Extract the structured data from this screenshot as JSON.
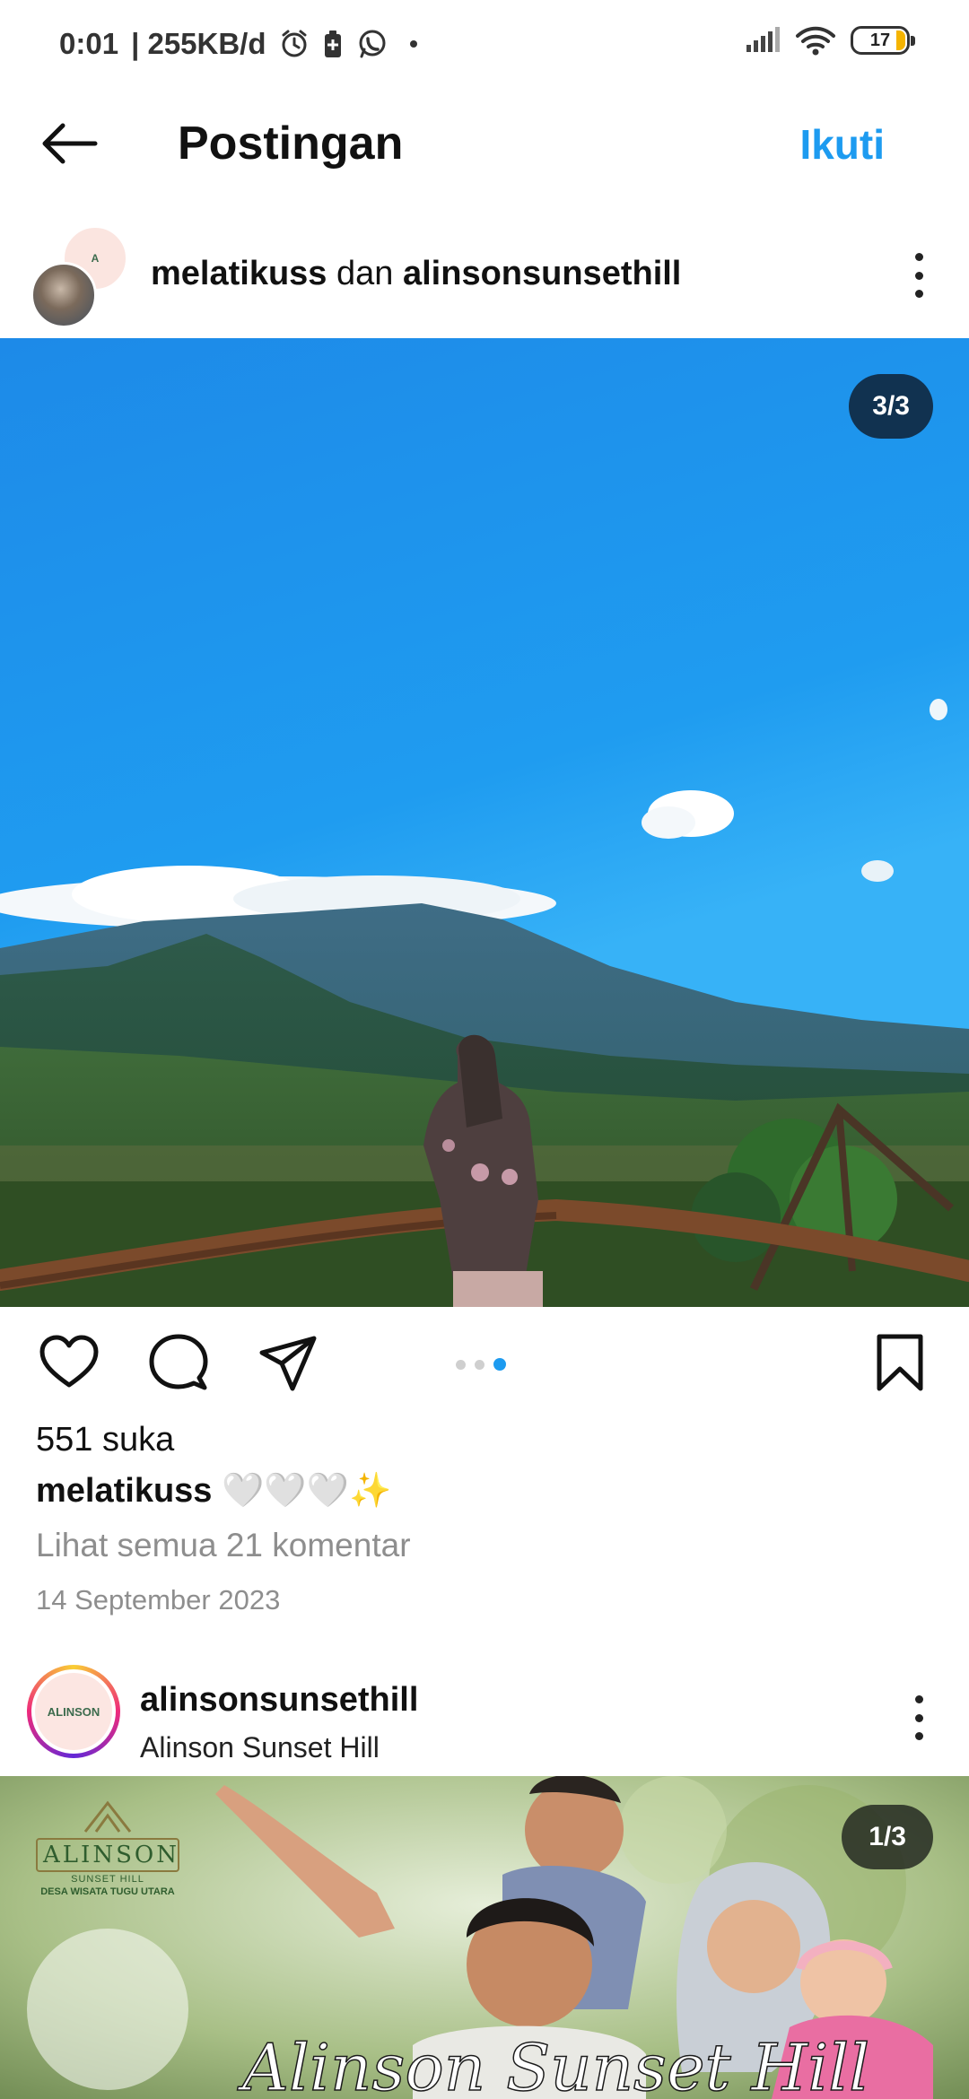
{
  "status_bar": {
    "time": "0:01",
    "speed": "| 255KB/d",
    "battery": "17"
  },
  "header": {
    "title": "Postingan",
    "follow_label": "Ikuti"
  },
  "post": {
    "user1": "melatikuss",
    "connector": "dan",
    "user2": "alinsonsunsethill",
    "image_counter": "3/3",
    "likes": "551 suka",
    "caption_user": "melatikuss",
    "caption_text": "🤍🤍🤍✨",
    "comments_link": "Lihat semua 21 komentar",
    "date": "14 September 2023",
    "carousel_active_index": 3,
    "carousel_total": 3
  },
  "next_post": {
    "username": "alinsonsunsethill",
    "location": "Alinson Sunset Hill",
    "image_counter": "1/3",
    "brand_name": "ALINSON",
    "brand_sub": "SUNSET HILL",
    "brand_tagline": "DESA WISATA TUGU UTARA",
    "banner_script": "Alinson Sunset Hill"
  },
  "colors": {
    "accent": "#1d9bf0",
    "muted_text": "#8e8e8e"
  }
}
